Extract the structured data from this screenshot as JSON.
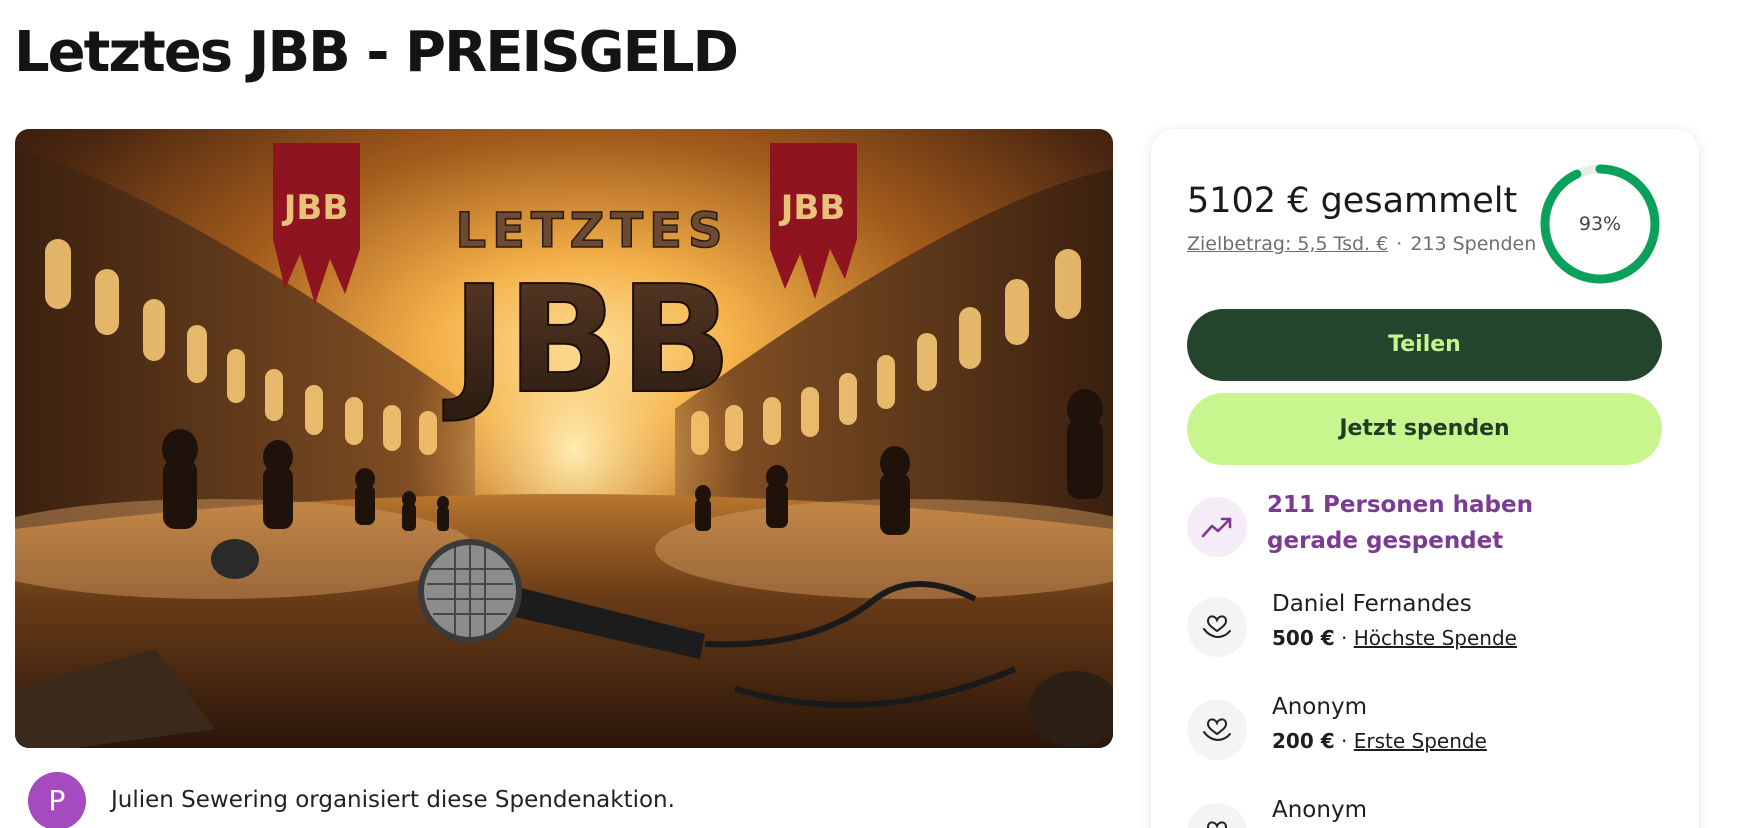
{
  "page": {
    "title": "Letztes JBB - PREISGELD"
  },
  "hero": {
    "image_text_line1": "LETZTES",
    "image_text_line2": "JBB",
    "banner_text": "JBB"
  },
  "organizer": {
    "avatar_letter": "P",
    "text": "Julien Sewering organisiert diese Spendenaktion.",
    "avatar_color": "#a64ac0"
  },
  "summary": {
    "raised": "5102 € gesammelt",
    "goal_label": "Zielbetrag: 5,5 Tsd. €",
    "separator": "·",
    "donation_count": "213 Spenden",
    "progress_label": "93%",
    "progress_value": 0.93,
    "progress_color": "#0ba15a"
  },
  "actions": {
    "share_label": "Teilen",
    "donate_label": "Jetzt spenden"
  },
  "trend": {
    "text": "211 Personen haben gerade gespendet",
    "icon": "trending-up-icon"
  },
  "donations": [
    {
      "name": "Daniel Fernandes",
      "amount": "500 €",
      "sep": "·",
      "note": "Höchste Spende",
      "icon": "heart-hand-icon"
    },
    {
      "name": "Anonym",
      "amount": "200 €",
      "sep": "·",
      "note": "Erste Spende",
      "icon": "heart-hand-icon"
    },
    {
      "name": "Anonym",
      "amount": "",
      "sep": "",
      "note": "",
      "icon": "heart-hand-icon"
    }
  ],
  "colors": {
    "share_bg": "#24452b",
    "share_text": "#c8f58e",
    "donate_bg": "#c9f58e",
    "trend_text": "#7b3b92"
  }
}
